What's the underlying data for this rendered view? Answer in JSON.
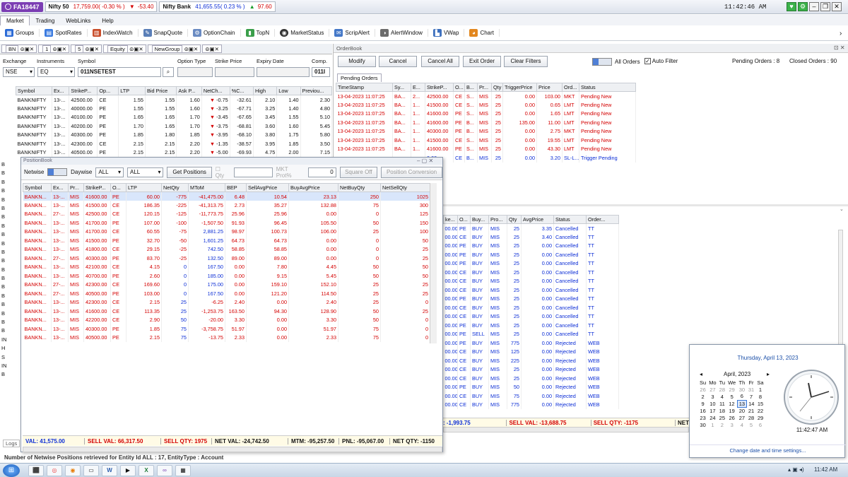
{
  "topbar": {
    "account": "FA18447",
    "nifty50_label": "Nifty 50",
    "nifty50_value": "17,759.00( -0.30 % )",
    "nifty50_change": "-53.40",
    "niftybank_label": "Nifty Bank",
    "niftybank_value": "41,655.55( 0.23 % )",
    "niftybank_change": "97.60",
    "clock": "11:42:46 AM"
  },
  "menu": [
    "Market",
    "Trading",
    "WebLinks",
    "Help"
  ],
  "toolbar": [
    "Groups",
    "SpotRates",
    "IndexWatch",
    "SnapQuote",
    "OptionChain",
    "TopN",
    "MarketStatus",
    "ScripAlert",
    "AlertWindow",
    "VWap",
    "Chart"
  ],
  "tabs": {
    "bn": "BN",
    "t1": "1",
    "t5": "5",
    "equity": "Equity",
    "newgroup": "NewGroup"
  },
  "marketwatch": {
    "exchange_label": "Exchange",
    "instruments_label": "Instruments",
    "symbol_label": "Symbol",
    "option_type_label": "Option Type",
    "strike_label": "Strike Price",
    "expiry_label": "Expiry Date",
    "comp_label": "Comp.",
    "exchange": "NSE",
    "instrument": "EQ",
    "symbol": "011NSETEST",
    "comp": "011I",
    "columns": [
      "Symbol",
      "Ex...",
      "StrikeP...",
      "Op...",
      "LTP",
      "Bid Price",
      "Ask P...",
      "NetCh...",
      "%C...",
      "High",
      "Low",
      "Previou..."
    ],
    "rows": [
      [
        "BANKNIFTY",
        "13-...",
        "42500.00",
        "CE",
        "1.55",
        "1.55",
        "1.60",
        "-0.75",
        "-32.61",
        "2.10",
        "1.40",
        "2.30"
      ],
      [
        "BANKNIFTY",
        "13-...",
        "40000.00",
        "PE",
        "1.55",
        "1.55",
        "1.60",
        "-3.25",
        "-67.71",
        "3.25",
        "1.40",
        "4.80"
      ],
      [
        "BANKNIFTY",
        "13-...",
        "40100.00",
        "PE",
        "1.65",
        "1.65",
        "1.70",
        "-3.45",
        "-67.65",
        "3.45",
        "1.55",
        "5.10"
      ],
      [
        "BANKNIFTY",
        "13-...",
        "40200.00",
        "PE",
        "1.70",
        "1.65",
        "1.70",
        "-3.75",
        "-68.81",
        "3.60",
        "1.60",
        "5.45"
      ],
      [
        "BANKNIFTY",
        "13-...",
        "40300.00",
        "PE",
        "1.85",
        "1.80",
        "1.85",
        "-3.95",
        "-68.10",
        "3.80",
        "1.75",
        "5.80"
      ],
      [
        "BANKNIFTY",
        "13-...",
        "42300.00",
        "CE",
        "2.15",
        "2.15",
        "2.20",
        "-1.35",
        "-38.57",
        "3.95",
        "1.85",
        "3.50"
      ],
      [
        "BANKNIFTY",
        "13-...",
        "40500.00",
        "PE",
        "2.15",
        "2.15",
        "2.20",
        "-5.00",
        "-69.93",
        "4.75",
        "2.00",
        "7.15"
      ]
    ]
  },
  "orderbook": {
    "title": "OrderBook",
    "modify": "Modify",
    "cancel": "Cancel",
    "cancel_all": "Cancel All",
    "exit_order": "Exit Order",
    "clear_filters": "Clear Filters",
    "all_orders": "All Orders",
    "auto_filter": "Auto Filter",
    "pending_summary": "Pending Orders : 8",
    "closed_summary": "Closed Orders : 90",
    "pending_tab": "Pending Orders",
    "columns": [
      "TimeStamp",
      "Sy...",
      "E...",
      "StrikeP...",
      "O...",
      "B...",
      "Pr...",
      "Qty",
      "TriggerPrice",
      "Price",
      "Ord...",
      "Status"
    ],
    "rows": [
      [
        "13-04-2023 11:07:25",
        "BA...",
        "2...",
        "42500.00",
        "CE",
        "S...",
        "MIS",
        "25",
        "0.00",
        "103.00",
        "MKT",
        "Pending New"
      ],
      [
        "13-04-2023 11:07:25",
        "BA...",
        "1...",
        "41500.00",
        "CE",
        "S...",
        "MIS",
        "25",
        "0.00",
        "0.65",
        "LMT",
        "Pending New"
      ],
      [
        "13-04-2023 11:07:25",
        "BA...",
        "1...",
        "41600.00",
        "PE",
        "S...",
        "MIS",
        "25",
        "0.00",
        "1.65",
        "LMT",
        "Pending New"
      ],
      [
        "13-04-2023 11:07:25",
        "BA...",
        "1...",
        "41600.00",
        "PE",
        "B...",
        "MIS",
        "25",
        "135.00",
        "11.00",
        "LMT",
        "Pending New"
      ],
      [
        "13-04-2023 11:07:25",
        "BA...",
        "1...",
        "40300.00",
        "PE",
        "B...",
        "MIS",
        "25",
        "0.00",
        "2.75",
        "MKT",
        "Pending New"
      ],
      [
        "13-04-2023 11:07:25",
        "BA...",
        "1...",
        "41500.00",
        "CE",
        "S...",
        "MIS",
        "25",
        "0.00",
        "19.55",
        "LMT",
        "Pending New"
      ],
      [
        "13-04-2023 11:07:25",
        "BA...",
        "1...",
        "41600.00",
        "PE",
        "S...",
        "MIS",
        "25",
        "0.00",
        "43.30",
        "LMT",
        "Pending New"
      ],
      [
        "",
        "",
        "",
        "0.00",
        "CE",
        "B...",
        "MIS",
        "25",
        "0.00",
        "3.20",
        "SL-L...",
        "Trigger Pending"
      ]
    ]
  },
  "closed": {
    "columns": [
      "ke...",
      "O...",
      "Buy...",
      "Pro...",
      "Qty",
      "AvgPrice",
      "Status",
      "Order..."
    ],
    "rows": [
      [
        "00.00",
        "PE",
        "BUY",
        "MIS",
        "25",
        "3.35",
        "Cancelled",
        "TT"
      ],
      [
        "00.00",
        "CE",
        "BUY",
        "MIS",
        "25",
        "3.40",
        "Cancelled",
        "TT"
      ],
      [
        "00.00",
        "PE",
        "BUY",
        "MIS",
        "25",
        "0.00",
        "Cancelled",
        "TT"
      ],
      [
        "00.00",
        "PE",
        "BUY",
        "MIS",
        "25",
        "0.00",
        "Cancelled",
        "TT"
      ],
      [
        "00.00",
        "PE",
        "BUY",
        "MIS",
        "25",
        "0.00",
        "Cancelled",
        "TT"
      ],
      [
        "00.00",
        "CE",
        "BUY",
        "MIS",
        "25",
        "0.00",
        "Cancelled",
        "TT"
      ],
      [
        "00.00",
        "CE",
        "BUY",
        "MIS",
        "25",
        "0.00",
        "Cancelled",
        "TT"
      ],
      [
        "00.00",
        "CE",
        "BUY",
        "MIS",
        "25",
        "0.00",
        "Cancelled",
        "TT"
      ],
      [
        "00.00",
        "PE",
        "BUY",
        "MIS",
        "25",
        "0.00",
        "Cancelled",
        "TT"
      ],
      [
        "00.00",
        "CE",
        "BUY",
        "MIS",
        "25",
        "0.00",
        "Cancelled",
        "TT"
      ],
      [
        "00.00",
        "CE",
        "BUY",
        "MIS",
        "25",
        "0.00",
        "Cancelled",
        "TT"
      ],
      [
        "00.00",
        "PE",
        "BUY",
        "MIS",
        "25",
        "0.00",
        "Cancelled",
        "TT"
      ],
      [
        "00.00",
        "PE",
        "SELL",
        "MIS",
        "25",
        "0.00",
        "Cancelled",
        "TT"
      ],
      [
        "00.00",
        "PE",
        "BUY",
        "MIS",
        "775",
        "0.00",
        "Rejected",
        "WEB"
      ],
      [
        "00.00",
        "CE",
        "BUY",
        "MIS",
        "125",
        "0.00",
        "Rejected",
        "WEB"
      ],
      [
        "00.00",
        "CE",
        "BUY",
        "MIS",
        "225",
        "0.00",
        "Rejected",
        "WEB"
      ],
      [
        "00.00",
        "CE",
        "BUY",
        "MIS",
        "25",
        "0.00",
        "Rejected",
        "WEB"
      ],
      [
        "00.00",
        "CE",
        "BUY",
        "MIS",
        "25",
        "0.00",
        "Rejected",
        "WEB"
      ],
      [
        "00.00",
        "PE",
        "BUY",
        "MIS",
        "50",
        "0.00",
        "Rejected",
        "WEB"
      ],
      [
        "00.00",
        "CE",
        "BUY",
        "MIS",
        "75",
        "0.00",
        "Rejected",
        "WEB"
      ],
      [
        "00.00",
        "CE",
        "BUY",
        "MIS",
        "775",
        "0.00",
        "Rejected",
        "WEB"
      ]
    ],
    "foot_val": ": -1,993.75",
    "foot_sell_val": "SELL VAL: -13,688.75",
    "foot_sell_qty": "SELL QTY: -1175",
    "foot_net": "NET"
  },
  "positionbook": {
    "title": "PositionBook",
    "netwise": "Netwise",
    "daywise": "Daywise",
    "filter1": "ALL",
    "filter2": "ALL",
    "get_positions": "Get Positions",
    "qty_label": "Qty",
    "mkt_prot_label": "MKT Prot%",
    "mkt_prot_value": "0",
    "square_off": "Square Off",
    "position_conversion": "Position Conversion",
    "columns": [
      "Symbol",
      "Ex...",
      "Pr...",
      "StrikeP...",
      "O...",
      "LTP",
      "NetQty",
      "MToM",
      "BEP",
      "SellAvgPrice",
      "BuyAvgPrice",
      "NetBuyQty",
      "NetSellQty"
    ],
    "rows": [
      [
        "BANKN...",
        "13-...",
        "MIS",
        "41600.00",
        "PE",
        "60.00",
        "-775",
        "-41,475.00",
        "6.48",
        "10.54",
        "23.13",
        "250",
        "1025"
      ],
      [
        "BANKN...",
        "13-...",
        "MIS",
        "41500.00",
        "CE",
        "186.35",
        "-225",
        "-41,313.75",
        "2.73",
        "35.27",
        "132.88",
        "75",
        "300"
      ],
      [
        "BANKN...",
        "27-...",
        "MIS",
        "42500.00",
        "CE",
        "120.15",
        "-125",
        "-11,773.75",
        "25.96",
        "25.96",
        "0.00",
        "0",
        "125"
      ],
      [
        "BANKN...",
        "13-...",
        "MIS",
        "41700.00",
        "PE",
        "107.00",
        "-100",
        "-1,507.50",
        "91.93",
        "96.45",
        "105.50",
        "50",
        "150"
      ],
      [
        "BANKN...",
        "13-...",
        "MIS",
        "41700.00",
        "CE",
        "60.55",
        "-75",
        "2,881.25",
        "98.97",
        "100.73",
        "106.00",
        "25",
        "100"
      ],
      [
        "BANKN...",
        "13-...",
        "MIS",
        "41500.00",
        "PE",
        "32.70",
        "-50",
        "1,601.25",
        "64.73",
        "64.73",
        "0.00",
        "0",
        "50"
      ],
      [
        "BANKN...",
        "13-...",
        "MIS",
        "41800.00",
        "CE",
        "29.15",
        "-25",
        "742.50",
        "58.85",
        "58.85",
        "0.00",
        "0",
        "25"
      ],
      [
        "BANKN...",
        "27-...",
        "MIS",
        "40300.00",
        "PE",
        "83.70",
        "-25",
        "132.50",
        "89.00",
        "89.00",
        "0.00",
        "0",
        "25"
      ],
      [
        "BANKN...",
        "13-...",
        "MIS",
        "42100.00",
        "CE",
        "4.15",
        "0",
        "167.50",
        "0.00",
        "7.80",
        "4.45",
        "50",
        "50"
      ],
      [
        "BANKN...",
        "13-...",
        "MIS",
        "40700.00",
        "PE",
        "2.60",
        "0",
        "185.00",
        "0.00",
        "9.15",
        "5.45",
        "50",
        "50"
      ],
      [
        "BANKN...",
        "27-...",
        "MIS",
        "42300.00",
        "CE",
        "169.60",
        "0",
        "175.00",
        "0.00",
        "159.10",
        "152.10",
        "25",
        "25"
      ],
      [
        "BANKN...",
        "27-...",
        "MIS",
        "40500.00",
        "PE",
        "103.00",
        "0",
        "167.50",
        "0.00",
        "121.20",
        "114.50",
        "25",
        "25"
      ],
      [
        "BANKN...",
        "13-...",
        "MIS",
        "42300.00",
        "CE",
        "2.15",
        "25",
        "-6.25",
        "2.40",
        "0.00",
        "2.40",
        "25",
        "0"
      ],
      [
        "BANKN...",
        "13-...",
        "MIS",
        "41600.00",
        "CE",
        "113.35",
        "25",
        "-1,253.75",
        "163.50",
        "94.30",
        "128.90",
        "50",
        "25"
      ],
      [
        "BANKN...",
        "13-...",
        "MIS",
        "42200.00",
        "CE",
        "2.90",
        "50",
        "-20.00",
        "3.30",
        "0.00",
        "3.30",
        "50",
        "0"
      ],
      [
        "BANKN...",
        "13-...",
        "MIS",
        "40300.00",
        "PE",
        "1.85",
        "75",
        "-3,758.75",
        "51.97",
        "0.00",
        "51.97",
        "75",
        "0"
      ],
      [
        "BANKN...",
        "13-...",
        "MIS",
        "40500.00",
        "PE",
        "2.15",
        "75",
        "-13.75",
        "2.33",
        "0.00",
        "2.33",
        "75",
        "0"
      ]
    ],
    "foot": {
      "val": "VAL: 41,575.00",
      "sell_val": "SELL VAL: 66,317.50",
      "sell_qty": "SELL QTY: 1975",
      "net_val": "NET VAL: -24,742.50",
      "mtm": "MTM: -95,257.50",
      "pnl": "PNL: -95,067.00",
      "net_qty": "NET QTY: -1150"
    }
  },
  "left_letters": [
    "B",
    "B",
    "B",
    "B",
    "B",
    "B",
    "B",
    "B",
    "B",
    "B",
    "B",
    "B",
    "B",
    "B",
    "B",
    "B",
    "B",
    "B",
    "B",
    "B",
    "IN",
    "H",
    "S",
    "IN",
    "B"
  ],
  "logs_label": "Logs",
  "status_message": "Number of Netwise Positions retrieved for Entity Id ALL : 17, EntityType : Account",
  "calendar": {
    "long_date": "Thursday, April 13, 2023",
    "month": "April, 2023",
    "days": [
      "Su",
      "Mo",
      "Tu",
      "We",
      "Th",
      "Fr",
      "Sa"
    ],
    "weeks": [
      [
        "26",
        "27",
        "28",
        "29",
        "30",
        "31",
        "1"
      ],
      [
        "2",
        "3",
        "4",
        "5",
        "6",
        "7",
        "8"
      ],
      [
        "9",
        "10",
        "11",
        "12",
        "13",
        "14",
        "15"
      ],
      [
        "16",
        "17",
        "18",
        "19",
        "20",
        "21",
        "22"
      ],
      [
        "23",
        "24",
        "25",
        "26",
        "27",
        "28",
        "29"
      ],
      [
        "30",
        "1",
        "2",
        "3",
        "4",
        "5",
        "6"
      ]
    ],
    "selected": "13",
    "time": "11:42:47 AM",
    "change_link": "Change date and time settings..."
  },
  "taskbar": {
    "time": "11:42 AM"
  }
}
